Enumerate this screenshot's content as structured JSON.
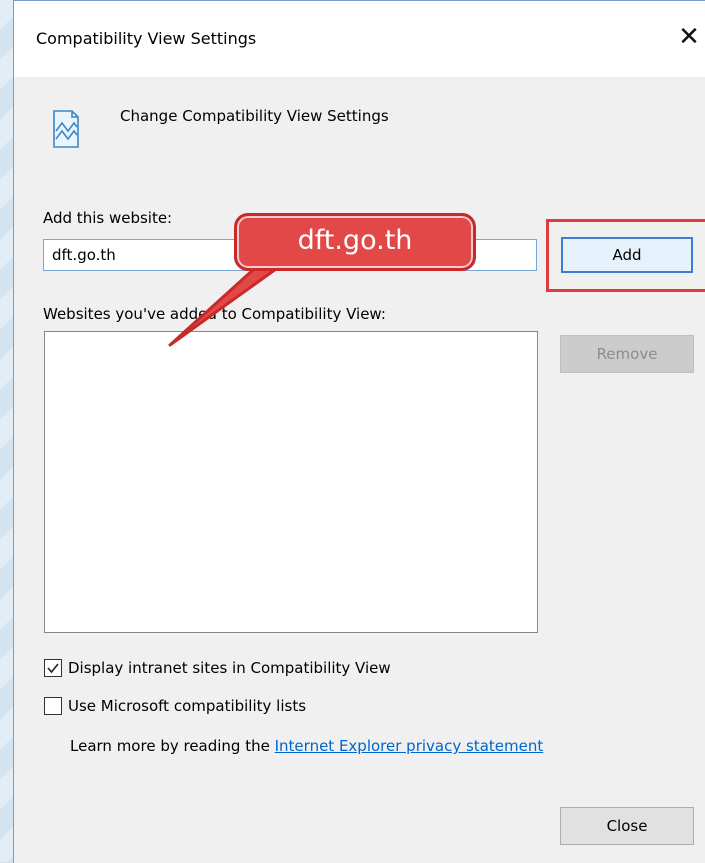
{
  "dialog": {
    "title": "Compatibility View Settings",
    "close_glyph": "✕",
    "header_text": "Change Compatibility View Settings",
    "add_label": "Add this website:",
    "input_value": "dft.go.th",
    "add_button": "Add",
    "list_label": "Websites you've added to Compatibility View:",
    "remove_button": "Remove",
    "checkbox_intranet": "Display intranet sites in Compatibility View",
    "checkbox_intranet_checked": true,
    "checkbox_ms_lists": "Use Microsoft compatibility lists",
    "checkbox_ms_lists_checked": false,
    "learn_more_prefix": "Learn more by reading the",
    "learn_more_link": "Internet Explorer privacy statement",
    "close_button": "Close"
  },
  "annotation": {
    "callout_text": "dft.go.th",
    "callout_color": "#e34848",
    "highlight_color": "#e03a3a"
  }
}
